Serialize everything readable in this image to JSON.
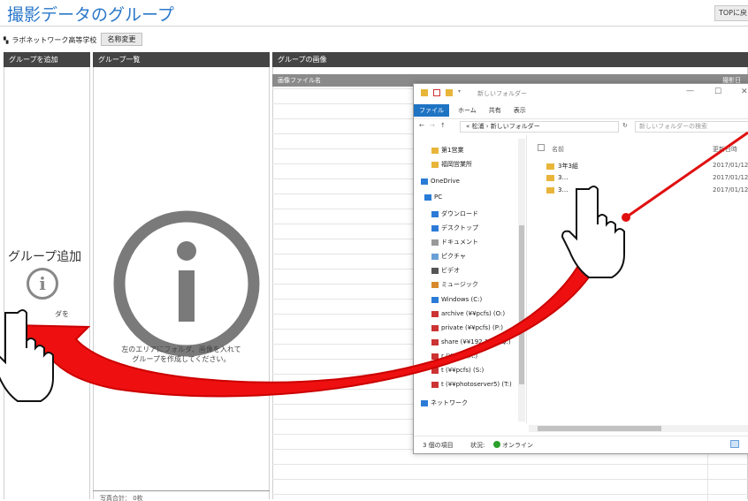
{
  "header": {
    "title": "撮影データのグループ",
    "top_button": "TOPに戻る",
    "school_name": "ラボネットワーク高等学校",
    "rename_button": "名称変更"
  },
  "columns": {
    "add_group": "グループを追加",
    "group_list": "グループ一覧",
    "group_images": "グループの画像"
  },
  "add_panel": {
    "label": "グループ追加",
    "hint_partial": "ダを"
  },
  "group_list_panel": {
    "drop_message_line1": "左のエリアにフォルダ、画像を入れて",
    "drop_message_line2": "グループを作成してください。",
    "status_partial": "写真合計： 0枚"
  },
  "images_panel": {
    "col_filename": "画像ファイル名",
    "col_date": "撮影日"
  },
  "explorer": {
    "title": "新しいフォルダー",
    "ribbon_tabs": [
      "ファイル",
      "ホーム",
      "共有",
      "表示"
    ],
    "address": "« 松浦 › 新しいフォルダー",
    "search_placeholder": "新しいフォルダーの検索",
    "nav_items": [
      {
        "label": "第1営業",
        "icon": "folder-icon"
      },
      {
        "label": "福岡営業所",
        "icon": "folder-icon"
      },
      {
        "label": "OneDrive",
        "icon": "cloud-icon"
      },
      {
        "label": "PC",
        "icon": "pc-icon"
      },
      {
        "label": "ダウンロード",
        "icon": "download-icon"
      },
      {
        "label": "デスクトップ",
        "icon": "desktop-icon"
      },
      {
        "label": "ドキュメント",
        "icon": "document-icon"
      },
      {
        "label": "ピクチャ",
        "icon": "picture-icon"
      },
      {
        "label": "ビデオ",
        "icon": "video-icon"
      },
      {
        "label": "ミュージック",
        "icon": "music-icon"
      },
      {
        "label": "Windows (C:)",
        "icon": "drive-icon"
      },
      {
        "label": "archive (¥¥pcfs) (O:)",
        "icon": "network-drive-icon"
      },
      {
        "label": "private (¥¥pcfs) (P:)",
        "icon": "network-drive-icon"
      },
      {
        "label": "share (¥¥192.1…) (Q:)",
        "icon": "network-drive-icon"
      },
      {
        "label": "r (¥¥…) (R:)",
        "icon": "network-drive-icon"
      },
      {
        "label": "t (¥¥pcfs) (S:)",
        "icon": "network-drive-icon"
      },
      {
        "label": "t (¥¥photoserver5) (T:)",
        "icon": "network-drive-icon"
      },
      {
        "label": "ネットワーク",
        "icon": "network-icon"
      }
    ],
    "col_name": "名前",
    "col_date": "更新日時",
    "files": [
      {
        "name": "3年3組",
        "date": "2017/01/12"
      },
      {
        "name": "3…",
        "date": "2017/01/12"
      },
      {
        "name": "3…",
        "date": "2017/01/12"
      }
    ],
    "status_count": "3 個の項目",
    "status_state": "状況: ",
    "status_online": "オンライン"
  },
  "colors": {
    "title_blue": "#2a77c9",
    "column_header": "#444444",
    "arrow_red": "#e01010",
    "ribbon_file": "#1e73c3"
  }
}
